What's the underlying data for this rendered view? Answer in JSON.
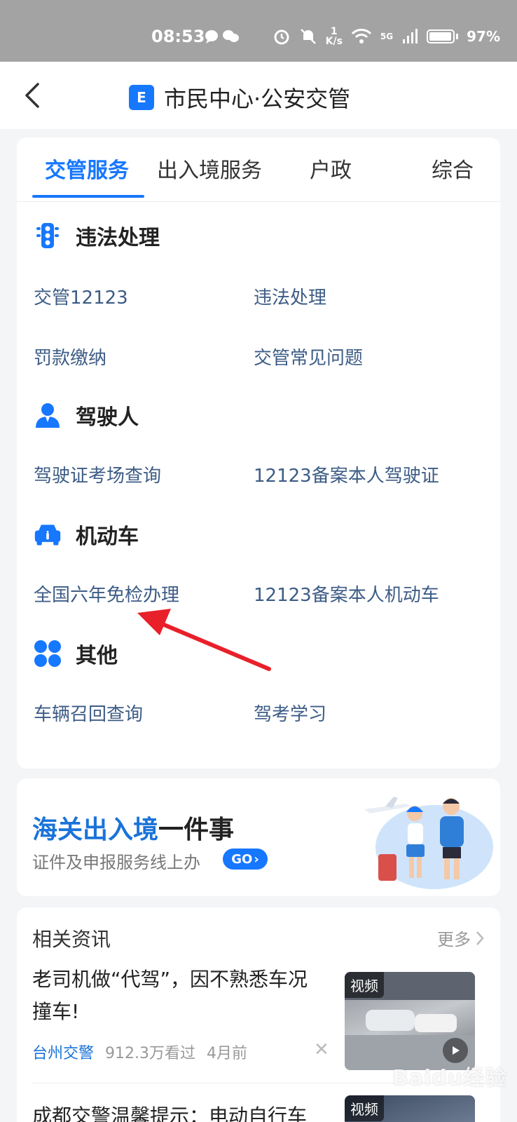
{
  "status_bar": {
    "time": "08:53",
    "net_speed_value": "1",
    "net_speed_unit": "K/s",
    "signal": "5G",
    "battery": "97%"
  },
  "nav": {
    "logo_glyph": "E",
    "title": "市民中心·公安交管"
  },
  "tabs": [
    {
      "label": "交管服务",
      "active": true
    },
    {
      "label": "出入境服务"
    },
    {
      "label": "户政"
    },
    {
      "label": "综合"
    }
  ],
  "sections": [
    {
      "title": "违法处理",
      "icon": "traffic-light-icon",
      "links": [
        "交管12123",
        "违法处理",
        "罚款缴纳",
        "交管常见问题"
      ]
    },
    {
      "title": "驾驶人",
      "icon": "driver-icon",
      "links": [
        "驾驶证考场查询",
        "12123备案本人驾驶证"
      ]
    },
    {
      "title": "机动车",
      "icon": "car-icon",
      "links": [
        "全国六年免检办理",
        "12123备案本人机动车"
      ]
    },
    {
      "title": "其他",
      "icon": "grid-icon",
      "links": [
        "车辆召回查询",
        "驾考学习"
      ]
    }
  ],
  "banner": {
    "title_highlight": "海关出入境",
    "title_rest": "一件事",
    "subtitle": "证件及申报服务线上办",
    "go_label": "GO"
  },
  "news": {
    "header": "相关资讯",
    "more": "更多",
    "items": [
      {
        "title": "老司机做“代驾”，因不熟悉车况撞车!",
        "source": "台州交警",
        "views": "912.3万看过",
        "time": "4月前",
        "tag": "视频"
      },
      {
        "title": "成都交警温馨提示：电动自行车",
        "tag": "视频"
      }
    ]
  },
  "watermark": "Baidu经验",
  "colors": {
    "accent": "#1677ff",
    "link": "#3d5c86",
    "status_bar": "#a3a3a3",
    "annotation": "#e8202a"
  }
}
